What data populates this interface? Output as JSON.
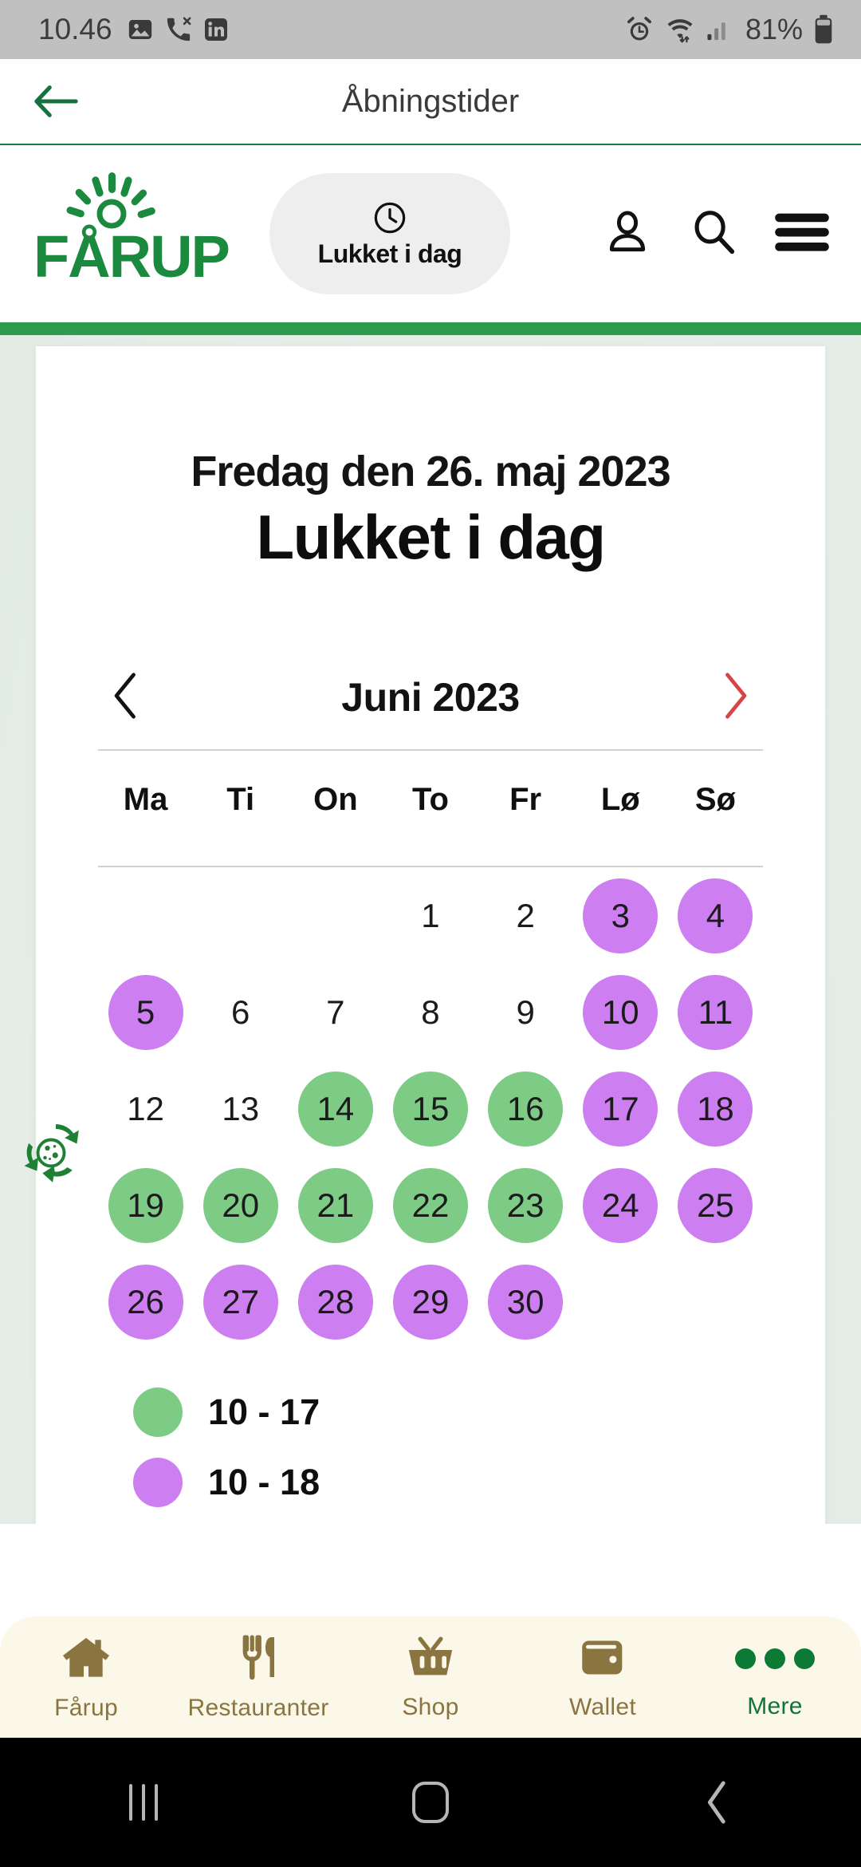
{
  "status_bar": {
    "time": "10.46",
    "left_icons": [
      "image-icon",
      "missed-call-icon",
      "linkedin-icon"
    ],
    "right_icons": [
      "alarm-icon",
      "wifi-icon",
      "signal-icon",
      "battery-icon"
    ],
    "battery_percent": "81%"
  },
  "title_bar": {
    "back_label": "back-arrow",
    "title": "Åbningstider",
    "accent_color": "#1d7a3f"
  },
  "site_header": {
    "logo_text": "FÅRUP",
    "logo_color": "#1b8a3e",
    "status_pill": {
      "icon": "clock-icon",
      "label": "Lukket i dag"
    },
    "actions": [
      {
        "name": "account-icon",
        "label": "Konto"
      },
      {
        "name": "search-icon",
        "label": "Søg"
      },
      {
        "name": "menu-icon",
        "label": "Menu"
      }
    ]
  },
  "main": {
    "date_heading": "Fredag den 26. maj 2023",
    "status_heading": "Lukket i dag",
    "calendar": {
      "month_label": "Juni 2023",
      "prev_arrow": "‹",
      "next_arrow": "›",
      "prev_color": "#111111",
      "next_color": "#d64545",
      "weekdays": [
        "Ma",
        "Ti",
        "On",
        "To",
        "Fr",
        "Lø",
        "Sø"
      ],
      "weeks": [
        [
          {
            "day": "",
            "state": "empty"
          },
          {
            "day": "",
            "state": "empty"
          },
          {
            "day": "",
            "state": "empty"
          },
          {
            "day": "1",
            "state": "plain"
          },
          {
            "day": "2",
            "state": "plain"
          },
          {
            "day": "3",
            "state": "purple"
          },
          {
            "day": "4",
            "state": "purple"
          }
        ],
        [
          {
            "day": "5",
            "state": "purple"
          },
          {
            "day": "6",
            "state": "plain"
          },
          {
            "day": "7",
            "state": "plain"
          },
          {
            "day": "8",
            "state": "plain"
          },
          {
            "day": "9",
            "state": "plain"
          },
          {
            "day": "10",
            "state": "purple"
          },
          {
            "day": "11",
            "state": "purple"
          }
        ],
        [
          {
            "day": "12",
            "state": "plain"
          },
          {
            "day": "13",
            "state": "plain"
          },
          {
            "day": "14",
            "state": "green"
          },
          {
            "day": "15",
            "state": "green"
          },
          {
            "day": "16",
            "state": "green"
          },
          {
            "day": "17",
            "state": "purple"
          },
          {
            "day": "18",
            "state": "purple"
          }
        ],
        [
          {
            "day": "19",
            "state": "green"
          },
          {
            "day": "20",
            "state": "green"
          },
          {
            "day": "21",
            "state": "green"
          },
          {
            "day": "22",
            "state": "green"
          },
          {
            "day": "23",
            "state": "green"
          },
          {
            "day": "24",
            "state": "purple"
          },
          {
            "day": "25",
            "state": "purple"
          }
        ],
        [
          {
            "day": "26",
            "state": "purple"
          },
          {
            "day": "27",
            "state": "purple"
          },
          {
            "day": "28",
            "state": "purple"
          },
          {
            "day": "29",
            "state": "purple"
          },
          {
            "day": "30",
            "state": "purple"
          },
          {
            "day": "",
            "state": "empty"
          },
          {
            "day": "",
            "state": "empty"
          }
        ]
      ],
      "legend": [
        {
          "color_name": "green",
          "color": "#7ecb86",
          "label": "10 - 17"
        },
        {
          "color_name": "purple",
          "color": "#cd7ef0",
          "label": "10 - 18"
        }
      ]
    }
  },
  "floating": {
    "recycle_icon": "cookie-recycle-icon",
    "recycle_color": "#1e8034"
  },
  "bottom_nav": {
    "items": [
      {
        "icon": "home-icon",
        "label": "Fårup",
        "active": false
      },
      {
        "icon": "restaurant-icon",
        "label": "Restauranter",
        "active": false
      },
      {
        "icon": "basket-icon",
        "label": "Shop",
        "active": false
      },
      {
        "icon": "wallet-icon",
        "label": "Wallet",
        "active": false
      },
      {
        "icon": "more-dots-icon",
        "label": "Mere",
        "active": true
      }
    ],
    "background": "#fcf8e9",
    "inactive_color": "#8a7440",
    "active_color": "#12743a"
  },
  "android_nav": {
    "recents": "recents-icon",
    "home": "home-button-icon",
    "back": "back-button-icon"
  }
}
